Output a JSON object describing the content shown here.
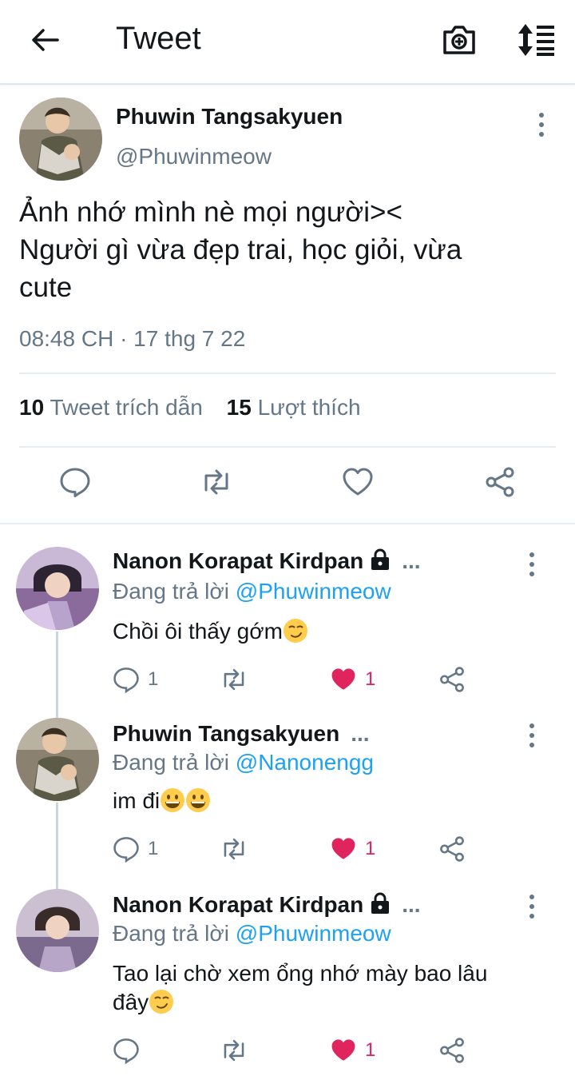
{
  "header": {
    "title": "Tweet",
    "back_icon": "back-arrow-icon",
    "camera_icon": "camera-add-icon",
    "sort_icon": "sort-icon"
  },
  "main_tweet": {
    "author_name": "Phuwin Tangsakyuen",
    "author_handle": "@Phuwinmeow",
    "text_lines": [
      "Ảnh nhớ mình nè mọi người><",
      "Người gì vừa đẹp trai, học giỏi, vừa",
      "cute"
    ],
    "timestamp": "08:48 CH · 17 thg 7 22",
    "quote_count": "10",
    "quote_label": "Tweet trích dẫn",
    "like_count": "15",
    "like_label": "Lượt thích"
  },
  "colors": {
    "accent": "#1da1f2",
    "like": "#e0245e",
    "secondary_text": "#657786",
    "divider": "#e6ecf0"
  },
  "replies": [
    {
      "author_name": "Nanon Korapat Kirdpan",
      "locked": true,
      "ellipsis": "...",
      "replying_prefix": "Đang trả lời",
      "replying_to": "@Phuwinmeow",
      "text": "Chồi ôi thấy gớm",
      "emoji": [
        "smirk-emoji"
      ],
      "reply_count": "1",
      "like_count": "1",
      "liked": true
    },
    {
      "author_name": "Phuwin Tangsakyuen",
      "locked": false,
      "ellipsis": "...",
      "replying_prefix": "Đang trả lời",
      "replying_to": "@Nanonengg",
      "text": "im đi",
      "emoji": [
        "grin-emoji",
        "grin-emoji"
      ],
      "reply_count": "1",
      "like_count": "1",
      "liked": true
    },
    {
      "author_name": "Nanon Korapat Kirdpan",
      "locked": true,
      "ellipsis": "...",
      "replying_prefix": "Đang trả lời",
      "replying_to": "@Phuwinmeow",
      "text_line1": "Tao lại chờ xem ổng nhớ mày bao lâu",
      "text_line2": "đây",
      "emoji": [
        "smirk-emoji"
      ],
      "reply_count": "",
      "like_count": "1",
      "liked": true
    }
  ]
}
